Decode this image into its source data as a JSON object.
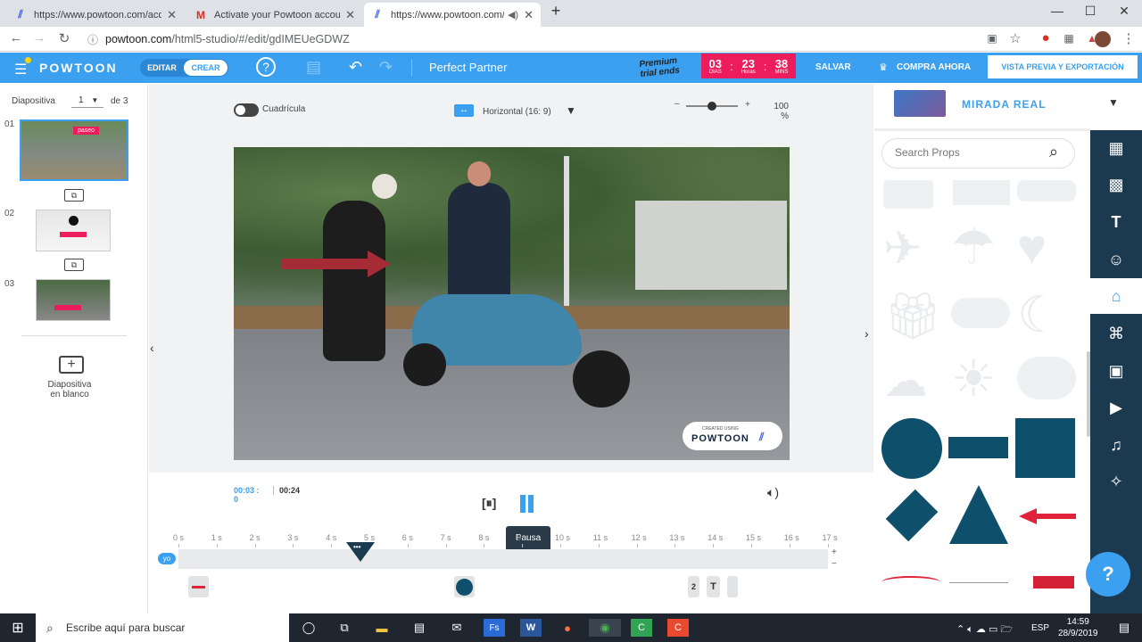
{
  "browser": {
    "tabs": [
      {
        "title": "https://www.powtoon.com/account",
        "active": false
      },
      {
        "title": "Activate your Powtoon account |",
        "active": false
      },
      {
        "title": "https://www.powtoon.com/h",
        "active": true
      }
    ],
    "new_tab": "+",
    "url_host": "powtoon.com",
    "url_path": "/html5-studio/#/edit/gdIMEUeGDWZ",
    "minimize": "—",
    "maximize": "☐",
    "close": "✕"
  },
  "header": {
    "logo": "POWTOON",
    "mode_edit": "EDITAR",
    "mode_create": "CREAR",
    "project_name": "Perfect Partner",
    "trial_line1": "Premium",
    "trial_line2": "trial ends",
    "timer": [
      {
        "value": "03",
        "unit": "DIAS"
      },
      {
        "value": "23",
        "unit": "Horas"
      },
      {
        "value": "38",
        "unit": "MINS"
      }
    ],
    "save": "SALVAR",
    "buy": "COMPRA AHORA",
    "preview": "VISTA PREVIA Y EXPORTACIÓN"
  },
  "slides": {
    "label": "Diapositiva",
    "current": "1",
    "of": "de 3",
    "items": [
      {
        "num": "01",
        "caption": "paseo"
      },
      {
        "num": "02",
        "caption": ""
      },
      {
        "num": "03",
        "caption": ""
      }
    ],
    "blank_line1": "Diapositiva",
    "blank_line2": "en blanco"
  },
  "stage": {
    "grid_label": "Cuadrícula",
    "orientation": "Horizontal (16: 9)",
    "zoom": "100",
    "zoom_unit": "%",
    "zoom_level": 0.5,
    "watermark_small": "CREATED USING",
    "watermark_big": "POWTOON"
  },
  "timeline": {
    "current_time": "00:03 :",
    "current_time2": "0",
    "total_time": "00:24",
    "pause_tooltip": "Pausa",
    "ticks": [
      "0 s",
      "1 s",
      "2 s",
      "3 s",
      "4 s",
      "5 s",
      "6 s",
      "7 s",
      "8 s",
      "9 s",
      "10 s",
      "11 s",
      "12 s",
      "13 s",
      "14 s",
      "15 s",
      "16 s",
      "17 s"
    ],
    "track_label": "yo",
    "playhead_label": "•••",
    "layer_badge": "2",
    "layer_text": "T",
    "plus": "+",
    "minus": "−"
  },
  "props": {
    "category": "MIRADA REAL",
    "search_placeholder": "Search Props",
    "colors": {
      "shape": "#0e4f6b",
      "arrow": "#e0233b"
    }
  },
  "taskbar": {
    "search": "Escribe aquí para buscar",
    "lang": "ESP",
    "time": "14:59",
    "date": "28/9/2019"
  }
}
